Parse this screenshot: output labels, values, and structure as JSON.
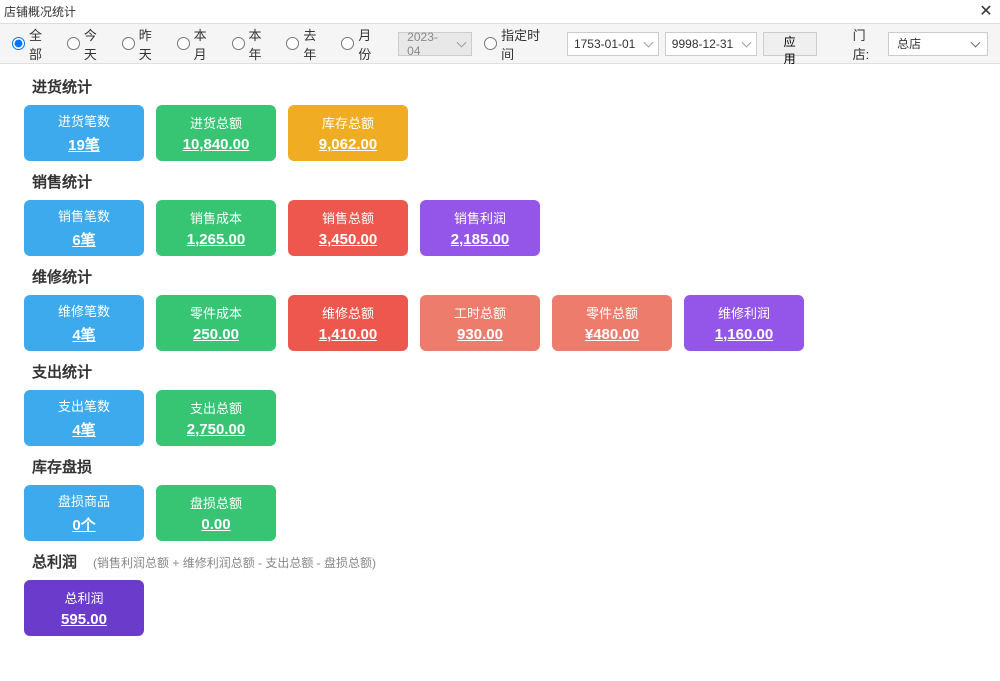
{
  "window": {
    "title": "店铺概况统计",
    "close": "✕"
  },
  "toolbar": {
    "radios": {
      "all": "全部",
      "today": "今天",
      "yesterday": "昨天",
      "thisMonth": "本月",
      "thisYear": "本年",
      "lastYear": "去年",
      "month": "月份",
      "custom": "指定时间"
    },
    "monthValue": "2023-04",
    "dateFrom": "1753-01-01",
    "dateTo": "9998-12-31",
    "applyLabel": "应用",
    "storeLabel": "门店:",
    "storeValue": "总店"
  },
  "sections": {
    "purchase": {
      "title": "进货统计",
      "cards": [
        {
          "label": "进货笔数",
          "value": "19笔",
          "color": "c-blue"
        },
        {
          "label": "进货总额",
          "value": "10,840.00",
          "color": "c-green"
        },
        {
          "label": "库存总额",
          "value": "9,062.00",
          "color": "c-orange"
        }
      ]
    },
    "sales": {
      "title": "销售统计",
      "cards": [
        {
          "label": "销售笔数",
          "value": "6笔",
          "color": "c-blue"
        },
        {
          "label": "销售成本",
          "value": "1,265.00",
          "color": "c-green"
        },
        {
          "label": "销售总额",
          "value": "3,450.00",
          "color": "c-red"
        },
        {
          "label": "销售利润",
          "value": "2,185.00",
          "color": "c-purple"
        }
      ]
    },
    "repair": {
      "title": "维修统计",
      "cards": [
        {
          "label": "维修笔数",
          "value": "4笔",
          "color": "c-blue"
        },
        {
          "label": "零件成本",
          "value": "250.00",
          "color": "c-green"
        },
        {
          "label": "维修总额",
          "value": "1,410.00",
          "color": "c-red"
        },
        {
          "label": "工时总额",
          "value": "930.00",
          "color": "c-coral"
        },
        {
          "label": "零件总额",
          "value": "¥480.00",
          "color": "c-coral"
        },
        {
          "label": "维修利润",
          "value": "1,160.00",
          "color": "c-purple"
        }
      ]
    },
    "expense": {
      "title": "支出统计",
      "cards": [
        {
          "label": "支出笔数",
          "value": "4笔",
          "color": "c-blue"
        },
        {
          "label": "支出总额",
          "value": "2,750.00",
          "color": "c-green"
        }
      ]
    },
    "loss": {
      "title": "库存盘损",
      "cards": [
        {
          "label": "盘损商品",
          "value": "0个",
          "color": "c-blue"
        },
        {
          "label": "盘损总额",
          "value": "0.00",
          "color": "c-green"
        }
      ]
    },
    "profit": {
      "title": "总利润",
      "subtitle": "(销售利润总额 + 维修利润总额 - 支出总额 - 盘损总额)",
      "cards": [
        {
          "label": "总利润",
          "value": "595.00",
          "color": "c-violet"
        }
      ]
    }
  }
}
